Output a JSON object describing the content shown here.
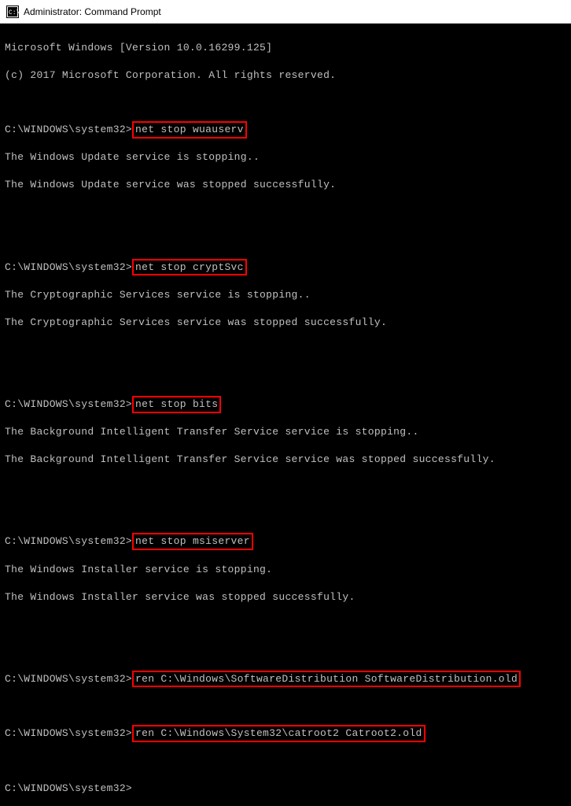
{
  "window": {
    "title": "Administrator: Command Prompt"
  },
  "terminal": {
    "header1": "Microsoft Windows [Version 10.0.16299.125]",
    "header2": "(c) 2017 Microsoft Corporation. All rights reserved.",
    "prompt": "C:\\WINDOWS\\system32>",
    "blocks": [
      {
        "cmd": "net stop wuauserv",
        "out1": "The Windows Update service is stopping..",
        "out2": "The Windows Update service was stopped successfully."
      },
      {
        "cmd": "net stop cryptSvc",
        "out1": "The Cryptographic Services service is stopping..",
        "out2": "The Cryptographic Services service was stopped successfully."
      },
      {
        "cmd": "net stop bits",
        "out1": "The Background Intelligent Transfer Service service is stopping..",
        "out2": "The Background Intelligent Transfer Service service was stopped successfully."
      },
      {
        "cmd": "net stop msiserver",
        "out1": "The Windows Installer service is stopping.",
        "out2": "The Windows Installer service was stopped successfully."
      }
    ],
    "ren1": "ren C:\\Windows\\SoftwareDistribution SoftwareDistribution.old",
    "ren2": "ren C:\\Windows\\System32\\catroot2 Catroot2.old"
  }
}
